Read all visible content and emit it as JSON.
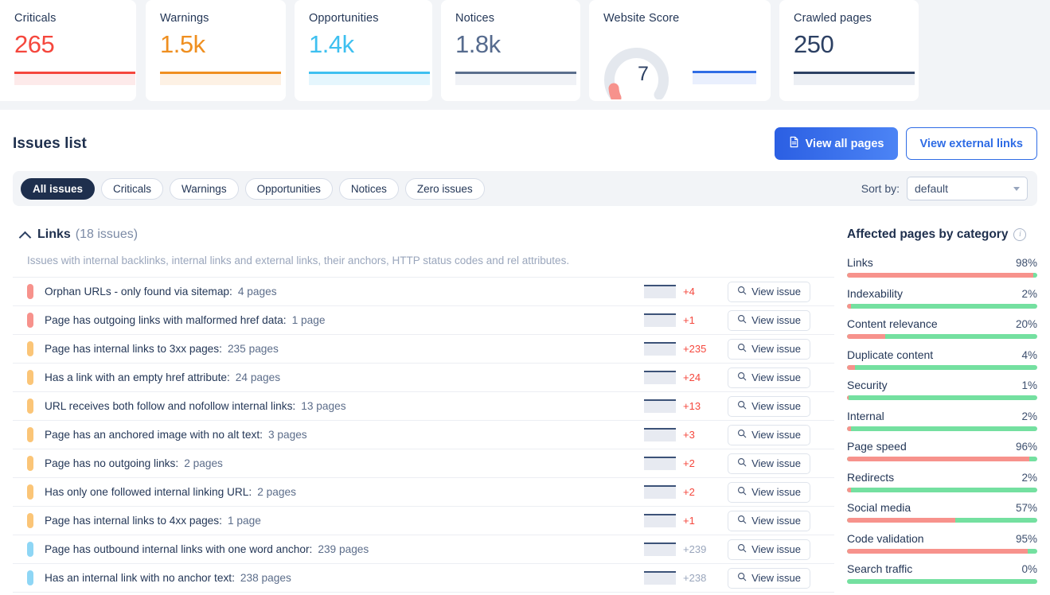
{
  "metrics": [
    {
      "title": "Criticals",
      "value": "265",
      "tone": "crit",
      "spark": "sp-crit"
    },
    {
      "title": "Warnings",
      "value": "1.5k",
      "tone": "warn",
      "spark": "sp-warn"
    },
    {
      "title": "Opportunities",
      "value": "1.4k",
      "tone": "opp",
      "spark": "sp-opp"
    },
    {
      "title": "Notices",
      "value": "1.8k",
      "tone": "not",
      "spark": "sp-not"
    },
    {
      "title": "Website Score",
      "value": "7",
      "tone": "score",
      "spark": "sp-blue"
    },
    {
      "title": "Crawled pages",
      "value": "250",
      "tone": "page",
      "spark": "sp-dark"
    }
  ],
  "panel": {
    "title": "Issues list",
    "view_all_pages": "View all pages",
    "view_external_links": "View external links"
  },
  "filters": {
    "pills": [
      "All issues",
      "Criticals",
      "Warnings",
      "Opportunities",
      "Notices",
      "Zero issues"
    ],
    "active": "All issues",
    "sort_label": "Sort by:",
    "sort_value": "default"
  },
  "section": {
    "name": "Links",
    "count": "(18 issues)",
    "description": "Issues with internal backlinks, internal links and external links, their anchors, HTTP status codes and rel attributes."
  },
  "view_issue_label": "View issue",
  "issues": [
    {
      "severity": "crit",
      "label": "Orphan URLs - only found via sitemap:",
      "count": "4 pages",
      "delta": "+4",
      "delta_tone": "d-red"
    },
    {
      "severity": "crit",
      "label": "Page has outgoing links with malformed href data:",
      "count": "1 page",
      "delta": "+1",
      "delta_tone": "d-red"
    },
    {
      "severity": "warn",
      "label": "Page has internal links to 3xx pages:",
      "count": "235 pages",
      "delta": "+235",
      "delta_tone": "d-red"
    },
    {
      "severity": "warn",
      "label": "Has a link with an empty href attribute:",
      "count": "24 pages",
      "delta": "+24",
      "delta_tone": "d-red"
    },
    {
      "severity": "warn",
      "label": "URL receives both follow and nofollow internal links:",
      "count": "13 pages",
      "delta": "+13",
      "delta_tone": "d-red"
    },
    {
      "severity": "warn",
      "label": "Page has an anchored image with no alt text:",
      "count": "3 pages",
      "delta": "+3",
      "delta_tone": "d-red"
    },
    {
      "severity": "warn",
      "label": "Page has no outgoing links:",
      "count": "2 pages",
      "delta": "+2",
      "delta_tone": "d-red"
    },
    {
      "severity": "warn",
      "label": "Has only one followed internal linking URL:",
      "count": "2 pages",
      "delta": "+2",
      "delta_tone": "d-red"
    },
    {
      "severity": "warn",
      "label": "Page has internal links to 4xx pages:",
      "count": "1 page",
      "delta": "+1",
      "delta_tone": "d-red"
    },
    {
      "severity": "opp",
      "label": "Page has outbound internal links with one word anchor:",
      "count": "239 pages",
      "delta": "+239",
      "delta_tone": "d-gray"
    },
    {
      "severity": "opp",
      "label": "Has an internal link with no anchor text:",
      "count": "238 pages",
      "delta": "+238",
      "delta_tone": "d-gray"
    }
  ],
  "categories": {
    "title": "Affected pages by category",
    "items": [
      {
        "name": "Links",
        "pct": "98%",
        "value": 98
      },
      {
        "name": "Indexability",
        "pct": "2%",
        "value": 2
      },
      {
        "name": "Content relevance",
        "pct": "20%",
        "value": 20
      },
      {
        "name": "Duplicate content",
        "pct": "4%",
        "value": 4
      },
      {
        "name": "Security",
        "pct": "1%",
        "value": 1
      },
      {
        "name": "Internal",
        "pct": "2%",
        "value": 2
      },
      {
        "name": "Page speed",
        "pct": "96%",
        "value": 96
      },
      {
        "name": "Redirects",
        "pct": "2%",
        "value": 2
      },
      {
        "name": "Social media",
        "pct": "57%",
        "value": 57
      },
      {
        "name": "Code validation",
        "pct": "95%",
        "value": 95
      },
      {
        "name": "Search traffic",
        "pct": "0%",
        "value": 0
      }
    ]
  },
  "chart_data": {
    "type": "bar",
    "title": "Affected pages by category",
    "categories": [
      "Links",
      "Indexability",
      "Content relevance",
      "Duplicate content",
      "Security",
      "Internal",
      "Page speed",
      "Redirects",
      "Social media",
      "Code validation",
      "Search traffic"
    ],
    "values": [
      98,
      2,
      20,
      4,
      1,
      2,
      96,
      2,
      57,
      95,
      0
    ],
    "unit": "%",
    "xlabel": "",
    "ylabel": "Affected pages",
    "ylim": [
      0,
      100
    ],
    "colors": {
      "affected": "#f7928c",
      "remaining": "#74e0a0"
    },
    "legend": "none",
    "grid": false
  },
  "score_gauge": {
    "type": "gauge",
    "label": "Website Score",
    "value": 7,
    "min": 0,
    "max": 100,
    "track_color": "#e4e8ee",
    "value_color": "#f7928c"
  },
  "colors": {
    "critical": "#f5473d",
    "warning": "#ef8f20",
    "opportunity": "#3ec0f0",
    "notice": "#566b8e",
    "primary": "#2f6ce5",
    "dark": "#1e2f4d"
  }
}
